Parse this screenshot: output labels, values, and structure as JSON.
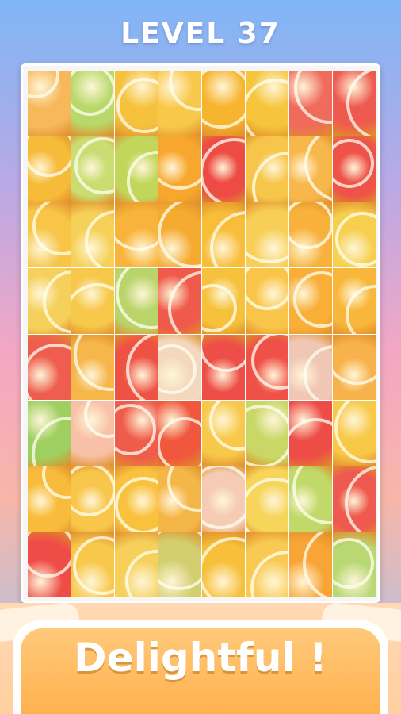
{
  "header": {
    "title": "LEVEL 37"
  },
  "puzzle": {
    "rows": 8,
    "cols": 8,
    "tile_colors": [
      [
        "#f7b85c",
        "#b7d96b",
        "#f6c23d",
        "#f8c84a",
        "#f7b42f",
        "#f6c53c",
        "#f06b5b",
        "#ee5a4f"
      ],
      [
        "#f7bb3a",
        "#c9dd73",
        "#c2d65b",
        "#f7a72e",
        "#ee4b45",
        "#f7c54a",
        "#f8b74a",
        "#ee5248"
      ],
      [
        "#f8c547",
        "#f6d15a",
        "#f8b43a",
        "#f5aa30",
        "#f8bd39",
        "#f7cf57",
        "#f8b23c",
        "#f6cf4e"
      ],
      [
        "#f5d05a",
        "#f8c84b",
        "#b9d46a",
        "#ef5a4a",
        "#f6c13b",
        "#f8c54a",
        "#f8ae37",
        "#f8b73b"
      ],
      [
        "#ee5d4f",
        "#f5b64a",
        "#ee5244",
        "#f3d8bd",
        "#ee4e48",
        "#ef5048",
        "#f0c6b4",
        "#f8b24b"
      ],
      [
        "#9fcf60",
        "#f8c0a6",
        "#ef5c4b",
        "#f0573d",
        "#f8c84a",
        "#c8d765",
        "#ee4d47",
        "#f8c847"
      ],
      [
        "#f8bb3c",
        "#f8c64b",
        "#f8c23f",
        "#f5b648",
        "#f5cbb4",
        "#f6d55a",
        "#c0d968",
        "#ee5a4f"
      ],
      [
        "#ef4c47",
        "#f8c84d",
        "#f6d05a",
        "#d3cf70",
        "#f7bf3a",
        "#f8ca54",
        "#f8a536",
        "#b8d873"
      ]
    ]
  },
  "banner": {
    "message": "Delightful !"
  }
}
